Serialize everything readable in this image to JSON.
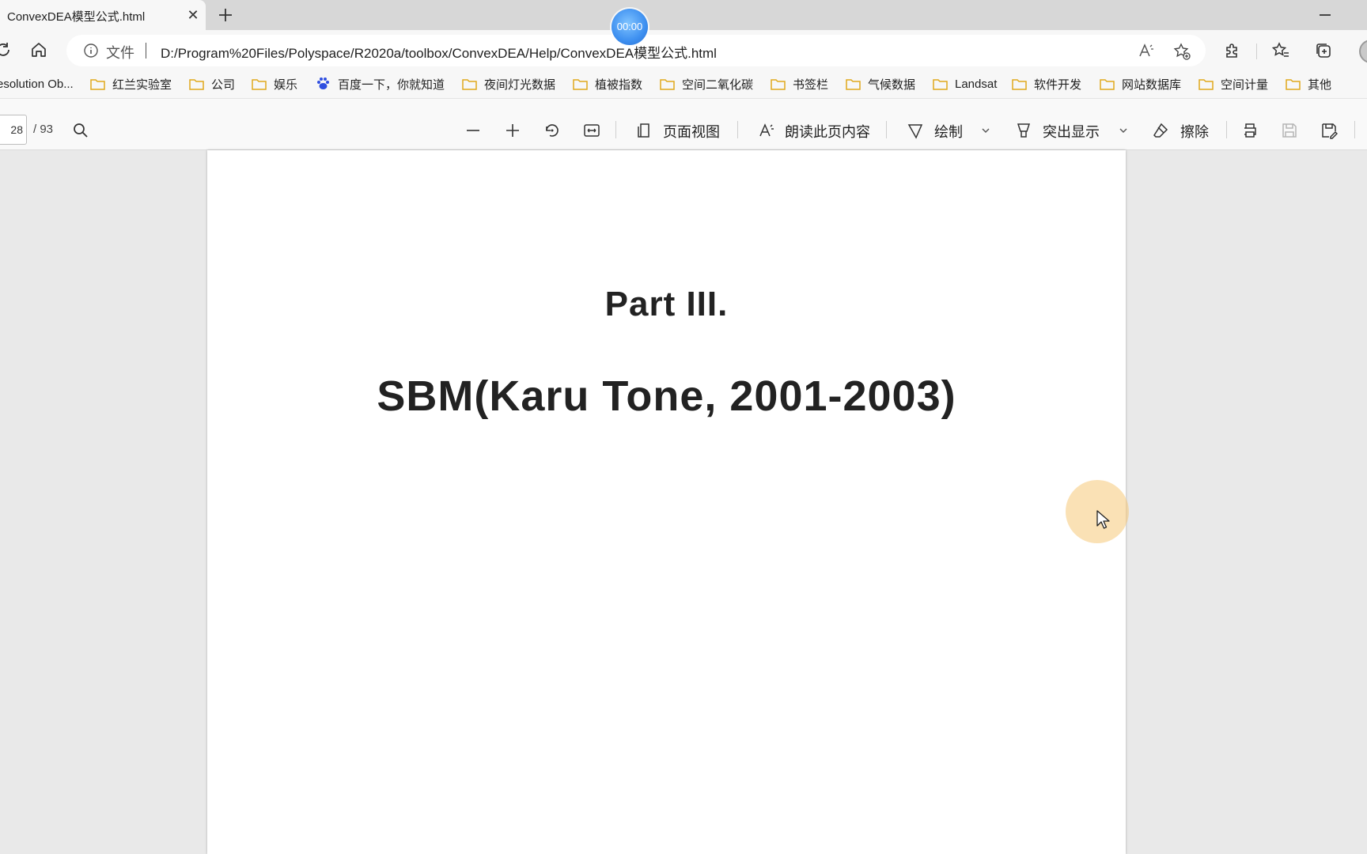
{
  "browser": {
    "tab": {
      "title": "ConvexDEA模型公式.html",
      "close_label": "✕"
    },
    "recording_timer": "00:00",
    "address": {
      "file_label": "文件",
      "url": "D:/Program%20Files/Polyspace/R2020a/toolbox/ConvexDEA/Help/ConvexDEA模型公式.html"
    },
    "bookmarks": [
      {
        "label": "esolution Ob...",
        "icon": "none"
      },
      {
        "label": "红兰实验室",
        "icon": "folder-icon"
      },
      {
        "label": "公司",
        "icon": "folder-icon"
      },
      {
        "label": "娱乐",
        "icon": "folder-icon"
      },
      {
        "label": "百度一下，你就知道",
        "icon": "baidu-paw-icon"
      },
      {
        "label": "夜间灯光数据",
        "icon": "folder-icon"
      },
      {
        "label": "植被指数",
        "icon": "folder-icon"
      },
      {
        "label": "空间二氧化碳",
        "icon": "folder-icon"
      },
      {
        "label": "书签栏",
        "icon": "folder-icon"
      },
      {
        "label": "气候数据",
        "icon": "folder-icon"
      },
      {
        "label": "Landsat",
        "icon": "folder-icon"
      },
      {
        "label": "软件开发",
        "icon": "folder-icon"
      },
      {
        "label": "网站数据库",
        "icon": "folder-icon"
      },
      {
        "label": "空间计量",
        "icon": "folder-icon"
      },
      {
        "label": "其他",
        "icon": "folder-icon"
      }
    ]
  },
  "pdf_toolbar": {
    "current_page": "28",
    "page_count": "/ 93",
    "page_view_label": "页面视图",
    "read_aloud_label": "朗读此页内容",
    "draw_label": "绘制",
    "highlight_label": "突出显示",
    "erase_label": "擦除"
  },
  "document": {
    "part_title": "Part III.",
    "main_title": "SBM(Karu Tone, 2001-2003)"
  },
  "colors": {
    "folder": "#f5c242",
    "recording_badge": "#3d8ff0",
    "cursor_halo": "#f5c878"
  }
}
